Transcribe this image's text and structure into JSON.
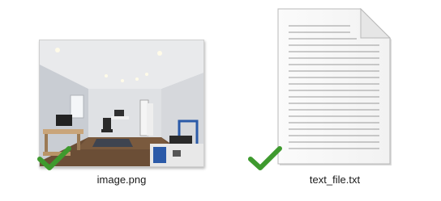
{
  "files": [
    {
      "name": "image.png",
      "type": "image",
      "status": "synced",
      "status_icon": "green-checkmark-icon"
    },
    {
      "name": "text_file.txt",
      "type": "text",
      "status": "synced",
      "status_icon": "green-checkmark-icon"
    }
  ],
  "colors": {
    "check_green": "#3e9a2e",
    "label_text": "#1a1a1a"
  }
}
